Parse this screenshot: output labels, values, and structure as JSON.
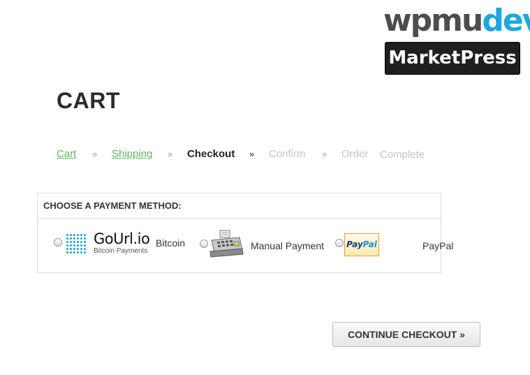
{
  "brand": {
    "wpmudev_part1": "wpmu",
    "wpmudev_part2": "dev",
    "marketpress": "MarketPress"
  },
  "page": {
    "title": "CART"
  },
  "steps": {
    "cart": "Cart",
    "shipping": "Shipping",
    "checkout": "Checkout",
    "confirm": "Confirm",
    "order": "Order",
    "complete": "Complete",
    "separator": "»"
  },
  "payment": {
    "heading": "CHOOSE A PAYMENT METHOD:",
    "options": [
      {
        "logo_name": "GoUrl.io",
        "logo_sub": "Bitcoin Payments",
        "label": "Bitcoin"
      },
      {
        "icon": "cash-register-icon",
        "label": "Manual Payment"
      },
      {
        "logo_pay": "Pay",
        "logo_pal": "Pal",
        "label": "PayPal"
      }
    ]
  },
  "actions": {
    "continue_label": "CONTINUE CHECKOUT »"
  },
  "colors": {
    "link_green": "#5cb85c",
    "disabled_gray": "#c4c4c4",
    "wpmu_gray": "#4d4d4f",
    "dev_blue": "#19a8e0",
    "gourl_blue": "#1aa3d8"
  }
}
